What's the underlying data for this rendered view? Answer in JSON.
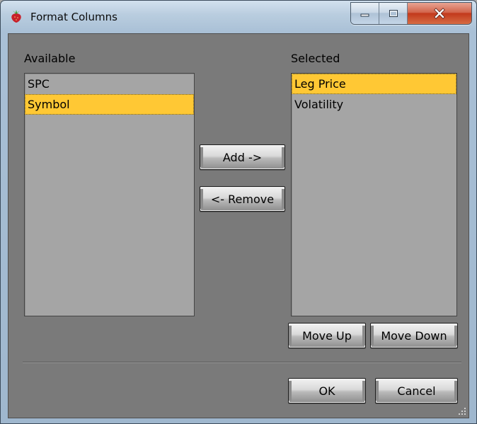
{
  "window": {
    "title": "Format Columns",
    "icon": "strawberry-app-icon",
    "controls": [
      "minimize-icon",
      "maximize-icon",
      "close-icon"
    ]
  },
  "available": {
    "label": "Available",
    "items": [
      "SPC",
      "Symbol"
    ],
    "selected_index": 1
  },
  "selected": {
    "label": "Selected",
    "items": [
      "Leg Price",
      "Volatility"
    ],
    "selected_index": 0
  },
  "buttons": {
    "add": "Add ->",
    "remove": "<- Remove",
    "move_up": "Move Up",
    "move_down": "Move Down",
    "ok": "OK",
    "cancel": "Cancel"
  },
  "colors": {
    "selection": "#ffc834",
    "client_background": "#7a7a7a",
    "list_background": "#a5a5a5"
  }
}
